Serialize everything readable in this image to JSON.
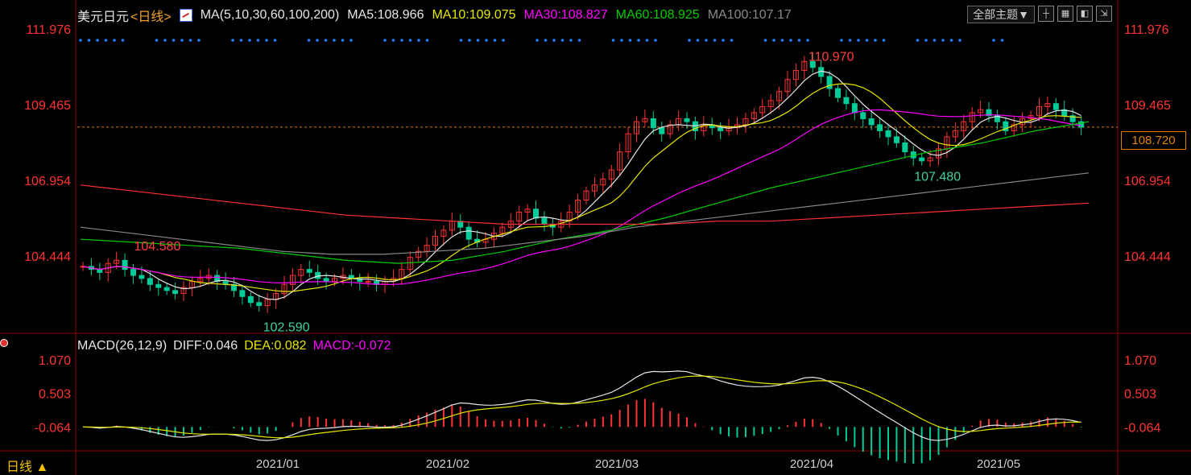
{
  "header": {
    "title": "美元日元",
    "period_label": "<日线>",
    "ma_label": "MA(5,10,30,60,100,200)",
    "ma5": "MA5:108.966",
    "ma10": "MA10:109.075",
    "ma30": "MA30:108.827",
    "ma60": "MA60:108.925",
    "ma100": "MA100:107.17"
  },
  "toolbar": {
    "theme_label": "全部主题▼",
    "buttons": [
      "cross-icon",
      "grid-icon",
      "layout-icon",
      "fullscreen-icon"
    ]
  },
  "price_axis": {
    "labels": [
      "111.976",
      "109.465",
      "106.954",
      "104.444"
    ],
    "current_price": "108.720"
  },
  "annotations": {
    "high": "110.970",
    "low": "102.590",
    "local_low": "107.480",
    "early_high": "104.580"
  },
  "macd": {
    "label": "MACD(26,12,9)",
    "diff": "DIFF:0.046",
    "dea": "DEA:0.082",
    "macd": "MACD:-0.072",
    "axis_labels": [
      "1.070",
      "0.503",
      "-0.064"
    ]
  },
  "time_axis": {
    "labels": [
      "2021/01",
      "2021/02",
      "2021/03",
      "2021/04",
      "2021/05"
    ]
  },
  "period_button": "日线 ▲",
  "colors": {
    "up": "#ff3333",
    "down": "#00cc99",
    "ma5": "#e6e6e6",
    "ma10": "#e6e600",
    "ma30": "#ff00ff",
    "ma60": "#00cc00",
    "ma100": "#888888",
    "ma200": "#ff3030",
    "axis_text": "#ff3333",
    "dots": "#2080ff"
  },
  "chart_data": {
    "type": "candlestick",
    "symbol": "美元日元",
    "ylim": [
      102.0,
      112.5
    ],
    "price_levels": [
      111.976,
      109.465,
      106.954,
      104.444
    ],
    "last_price": 108.72,
    "high": 110.97,
    "low": 102.59,
    "closes": [
      104.1,
      104.0,
      103.9,
      104.2,
      104.3,
      104.0,
      103.8,
      103.7,
      103.5,
      103.4,
      103.3,
      103.2,
      103.4,
      103.6,
      103.7,
      103.8,
      103.6,
      103.5,
      103.3,
      103.1,
      102.9,
      102.8,
      103.0,
      103.2,
      103.5,
      103.8,
      104.0,
      103.9,
      103.7,
      103.6,
      103.7,
      103.8,
      103.7,
      103.6,
      103.6,
      103.5,
      103.6,
      103.7,
      104.0,
      104.4,
      104.6,
      104.8,
      105.1,
      105.3,
      105.6,
      105.4,
      105.0,
      104.9,
      105.0,
      105.2,
      105.4,
      105.6,
      105.9,
      106.0,
      105.7,
      105.5,
      105.4,
      105.6,
      105.9,
      106.3,
      106.6,
      106.8,
      107.0,
      107.3,
      107.9,
      108.5,
      108.9,
      109.0,
      108.7,
      108.5,
      108.8,
      109.0,
      108.9,
      108.6,
      108.8,
      108.7,
      108.6,
      108.7,
      108.8,
      109.0,
      109.2,
      109.4,
      109.6,
      109.9,
      110.3,
      110.6,
      110.9,
      110.7,
      110.4,
      110.0,
      109.7,
      109.5,
      109.2,
      109.0,
      108.8,
      108.6,
      108.4,
      108.2,
      107.9,
      107.7,
      107.6,
      107.7,
      108.0,
      108.4,
      108.6,
      108.9,
      109.2,
      109.3,
      109.1,
      108.9,
      108.6,
      108.8,
      109.0,
      109.1,
      109.4,
      109.5,
      109.3,
      109.1,
      108.9,
      108.72
    ],
    "ma60": [
      105.0,
      104.9,
      104.8,
      104.7,
      104.5,
      104.3,
      104.2,
      104.3,
      104.6,
      105.0,
      105.3,
      105.7,
      106.2,
      106.7,
      107.1,
      107.5,
      107.9,
      108.2,
      108.6,
      108.9
    ],
    "ma100": [
      105.4,
      105.2,
      105.0,
      104.8,
      104.6,
      104.5,
      104.5,
      104.6,
      104.7,
      104.9,
      105.1,
      105.4,
      105.6,
      105.8,
      106.0,
      106.2,
      106.4,
      106.6,
      106.8,
      107.0,
      107.2
    ],
    "ma200": [
      106.8,
      106.6,
      106.4,
      106.2,
      106.0,
      105.8,
      105.7,
      105.6,
      105.5,
      105.5,
      105.5,
      105.5,
      105.6,
      105.6,
      105.7,
      105.8,
      105.9,
      106.0,
      106.1,
      106.2
    ],
    "ma_values": {
      "MA5": 108.966,
      "MA10": 109.075,
      "MA30": 108.827,
      "MA60": 108.925,
      "MA100": 107.17
    },
    "macd": {
      "diff": 0.046,
      "dea": 0.082,
      "macd": -0.072,
      "ylim": [
        -0.4,
        1.3
      ]
    },
    "x_tick_labels": [
      "2021/01",
      "2021/02",
      "2021/03",
      "2021/04",
      "2021/05"
    ]
  }
}
